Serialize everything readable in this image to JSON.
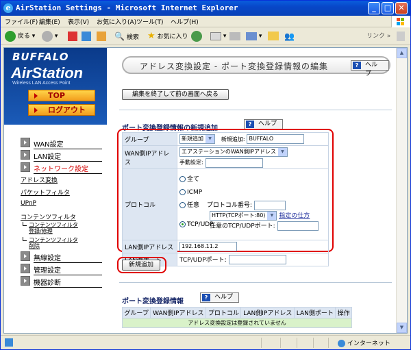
{
  "window": {
    "title": "AirStation Settings - Microsoft Internet Explorer"
  },
  "menubar": [
    "ファイル(F)",
    "編集(E)",
    "表示(V)",
    "お気に入り(A)",
    "ツール(T)",
    "ヘルプ(H)"
  ],
  "toolbar": {
    "back": "戻る",
    "search": "検索",
    "favorites": "お気に入り",
    "links": "リンク"
  },
  "brand": {
    "maker": "BUFFALO",
    "product": "AirStation",
    "tagline": "Wireless LAN Access Point"
  },
  "nav": {
    "top": "TOP",
    "logout": "ログアウト",
    "items": [
      {
        "label": "WAN設定"
      },
      {
        "label": "LAN設定"
      },
      {
        "label": "ネットワーク設定",
        "active": true
      },
      {
        "label": "無線設定"
      },
      {
        "label": "管理設定"
      },
      {
        "label": "機器診断"
      }
    ],
    "sub": [
      "アドレス変換",
      "パケットフィルタ",
      "UPnP",
      "コンテンツフィルタ"
    ],
    "subsub": [
      {
        "line1": "コンテンツフィルタ",
        "line2": "登録/修理"
      },
      {
        "line1": "コンテンツフィルタ",
        "line2": "削除"
      }
    ]
  },
  "page": {
    "title": "アドレス変換設定 - ポート変換登録情報の編集",
    "help": "ヘルプ",
    "back_button": "編集を終了して前の画面へ戻る",
    "new_section": "ポート変換登録情報の新規追加",
    "form": {
      "group_label": "グループ",
      "group_select": "新規追加",
      "new_add_label": "新規追加:",
      "new_add_value": "BUFFALO",
      "wan_label": "WAN側IPアドレス",
      "wan_select": "エアステーションのWAN側IPアドレス",
      "manual_label": "手動設定:",
      "protocol_label": "プロトコル",
      "protocol_all": "全て",
      "protocol_icmp": "ICMP",
      "protocol_any": "任意",
      "protocol_num_label": "プロトコル番号:",
      "protocol_tcpudp": "TCP/UDP",
      "tcpudp_select": "HTTP(TCPポート:80)",
      "howto_link": "指定の仕方",
      "any_port_label": "任意のTCP/UDPポート:",
      "lan_ip_label": "LAN側IPアドレス",
      "lan_ip_value": "192.168.11.2",
      "lan_port_label": "LAN側ポート",
      "tcpudp_port_label": "TCP/UDPポート:"
    },
    "add_button": "新規追加",
    "info_section": "ポート変換登録情報",
    "table": {
      "headers": [
        "グループ",
        "WAN側IPアドレス",
        "プロトコル",
        "LAN側IPアドレス",
        "LAN側ポート",
        "操作"
      ],
      "empty": "アドレス変換設定は登録されていません"
    }
  },
  "status": {
    "zone": "インターネット"
  }
}
